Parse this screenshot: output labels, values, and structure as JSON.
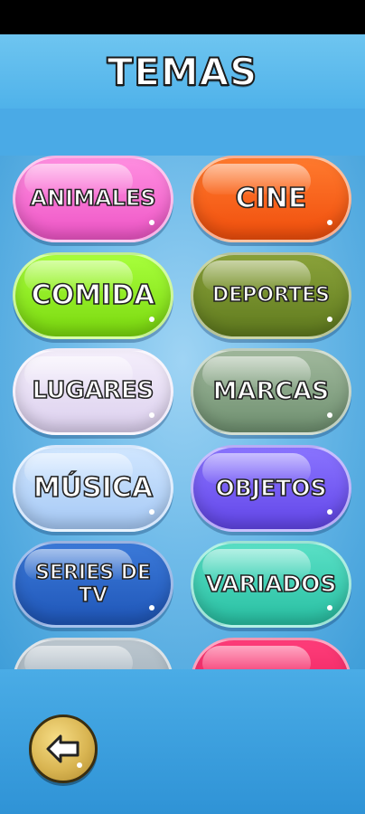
{
  "header": {
    "title": "TEMAS"
  },
  "topics": [
    {
      "label": "ANIMALES"
    },
    {
      "label": "CINE"
    },
    {
      "label": "COMIDA"
    },
    {
      "label": "DEPORTES"
    },
    {
      "label": "LUGARES"
    },
    {
      "label": "MARCAS"
    },
    {
      "label": "MÚSICA"
    },
    {
      "label": "OBJETOS"
    },
    {
      "label": "SERIES DE TV"
    },
    {
      "label": "VARIADOS"
    }
  ],
  "footer": {
    "back_icon": "back-arrow-icon"
  },
  "colors": {
    "accent": "#3aa0dc",
    "pink": "#ee55c6",
    "orange": "#f04e0c",
    "lime": "#7ad80e",
    "olive": "#5f7a1e",
    "lavender": "#dcd0ee",
    "sage": "#6f9070",
    "pale_blue": "#a6c9f5",
    "purple": "#6246e8",
    "blue": "#1f56b8",
    "teal": "#28bfa2",
    "grey": "#93a4b0",
    "red": "#e21a55"
  }
}
